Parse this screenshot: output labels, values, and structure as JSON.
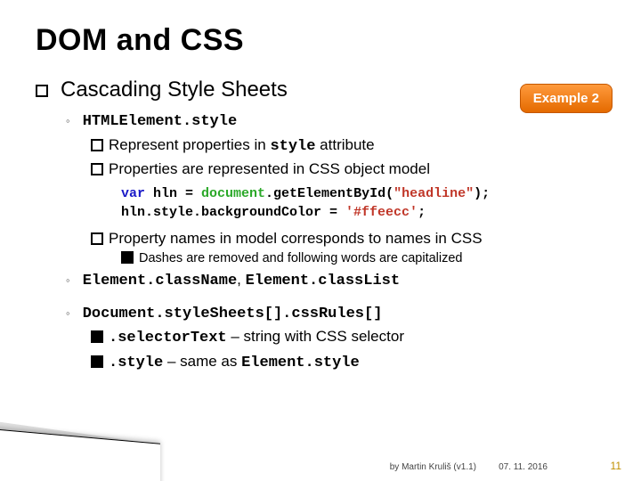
{
  "title": "DOM and CSS",
  "badge": "Example 2",
  "h1": "Cascading Style Sheets",
  "b1": {
    "code": "HTMLElement.style"
  },
  "b1a": {
    "pre": "Represent properties in ",
    "code": "style",
    "post": " attribute"
  },
  "b1b": "Properties are represented in CSS object model",
  "code": {
    "l1": {
      "kw": "var",
      "t1": " hln = ",
      "obj": "document",
      "t2": ".getElementById(",
      "str": "\"headline\"",
      "t3": ");"
    },
    "l2": {
      "t1": "hln.style.backgroundColor = ",
      "str": "'#ffeecc'",
      "t2": ";"
    }
  },
  "b1c": "Property names in model corresponds to names in CSS",
  "b1c1": "Dashes are removed and following words are capitalized",
  "b2": {
    "c1": "Element.className",
    "sep": ", ",
    "c2": "Element.classList"
  },
  "b3": {
    "code": "Document.styleSheets[].cssRules[]"
  },
  "b3a": {
    "code": ".selectorText",
    "post": " – string with CSS selector"
  },
  "b3b": {
    "code": ".style",
    "mid": " – same as ",
    "code2": "Element.style"
  },
  "footer": {
    "author": "by Martin Kruliš (v1.1)",
    "date": "07. 11. 2016",
    "page": "11"
  }
}
